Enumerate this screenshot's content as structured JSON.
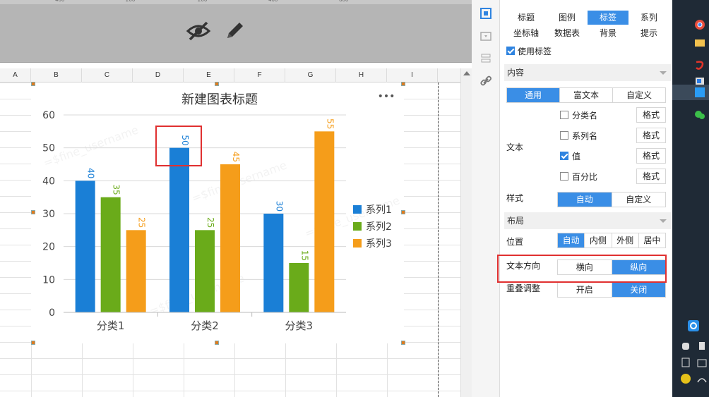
{
  "ruler": {
    "ticks": [
      "400",
      "200",
      "200",
      "400",
      "600"
    ]
  },
  "toolbar": {
    "icons": [
      "eye-off-icon",
      "pencil-icon"
    ]
  },
  "sheet": {
    "columns": [
      "A",
      "B",
      "C",
      "D",
      "E",
      "F",
      "G",
      "H",
      "I"
    ]
  },
  "watermark": "=$fine_username",
  "chart_data": {
    "type": "bar",
    "title": "新建图表标题",
    "categories": [
      "分类1",
      "分类2",
      "分类3"
    ],
    "series": [
      {
        "name": "系列1",
        "values": [
          40,
          50,
          30
        ],
        "color": "#1a7fd6"
      },
      {
        "name": "系列2",
        "values": [
          35,
          25,
          15
        ],
        "color": "#6aab1a"
      },
      {
        "name": "系列3",
        "values": [
          25,
          45,
          55
        ],
        "color": "#f59d1a"
      }
    ],
    "yticks": [
      0,
      10,
      20,
      30,
      40,
      50,
      60
    ],
    "ylim": [
      0,
      60
    ],
    "legend_position": "right",
    "data_labels": "vertical",
    "grid": true,
    "menu_label": "•••"
  },
  "panel": {
    "tabs": [
      {
        "label": "标题",
        "active": false
      },
      {
        "label": "图例",
        "active": false
      },
      {
        "label": "标签",
        "active": true
      },
      {
        "label": "系列",
        "active": false
      },
      {
        "label": "坐标轴",
        "active": false
      },
      {
        "label": "数据表",
        "active": false
      },
      {
        "label": "背景",
        "active": false
      },
      {
        "label": "提示",
        "active": false
      }
    ],
    "use_label": {
      "text": "使用标签",
      "checked": true
    },
    "content_section": "内容",
    "content_tabs": [
      {
        "label": "通用",
        "active": true
      },
      {
        "label": "富文本",
        "active": false
      },
      {
        "label": "自定义",
        "active": false
      }
    ],
    "text_label": "文本",
    "text_options": [
      {
        "label": "分类名",
        "checked": false,
        "button": "格式"
      },
      {
        "label": "系列名",
        "checked": false,
        "button": "格式"
      },
      {
        "label": "值",
        "checked": true,
        "button": "格式"
      },
      {
        "label": "百分比",
        "checked": false,
        "button": "格式"
      }
    ],
    "style_label": "样式",
    "style_options": [
      {
        "label": "自动",
        "active": true
      },
      {
        "label": "自定义",
        "active": false
      }
    ],
    "layout_section": "布局",
    "position_label": "位置",
    "position_options": [
      {
        "label": "自动",
        "active": true
      },
      {
        "label": "内侧",
        "active": false
      },
      {
        "label": "外侧",
        "active": false
      },
      {
        "label": "居中",
        "active": false
      }
    ],
    "direction_label": "文本方向",
    "direction_options": [
      {
        "label": "横向",
        "active": false
      },
      {
        "label": "纵向",
        "active": true
      }
    ],
    "overlap_label": "重叠调整",
    "overlap_options": [
      {
        "label": "开启",
        "active": false
      },
      {
        "label": "关闭",
        "active": true
      }
    ]
  },
  "colors": {
    "accent": "#3a8ee6",
    "highlight": "#e03030",
    "taskbar": "#1f2a36"
  }
}
